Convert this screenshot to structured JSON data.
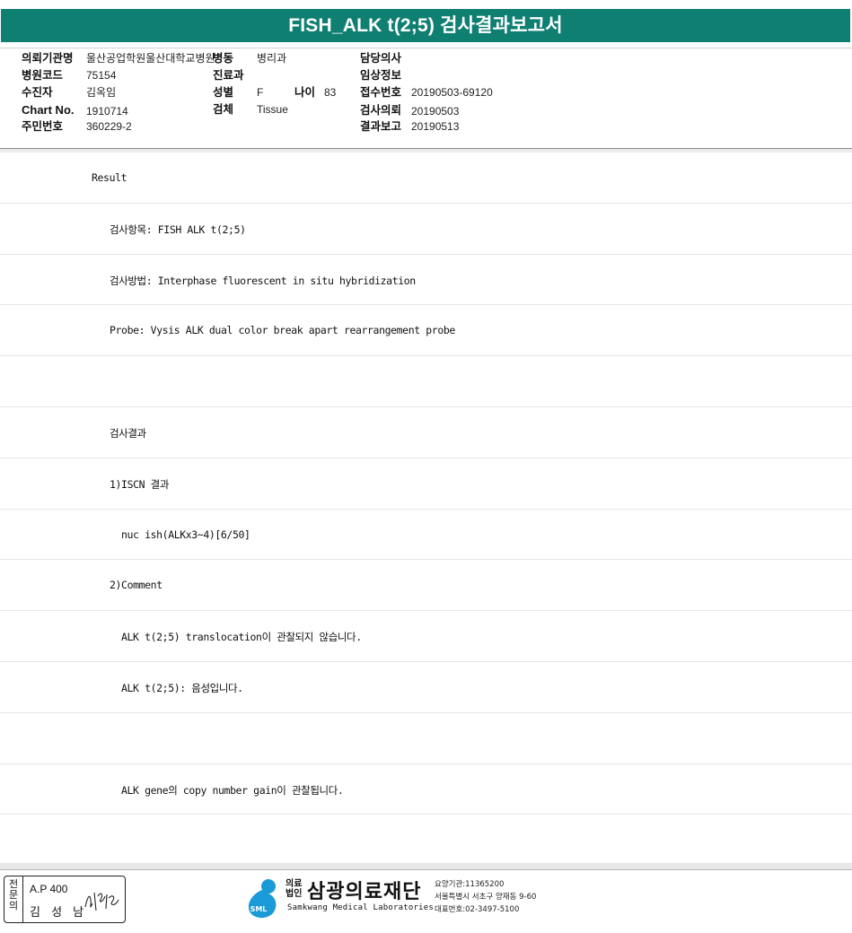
{
  "title": "FISH_ALK t(2;5) 검사결과보고서",
  "info": {
    "institution_label": "의뢰기관명",
    "institution_value": "울산공업학원울산대학교병원",
    "ward_label": "병동",
    "ward_value": "병리과",
    "doctor_label": "담당의사",
    "doctor_value": "",
    "hospital_code_label": "병원코드",
    "hospital_code_value": "75154",
    "dept_label": "진료과",
    "dept_value": "",
    "clinical_label": "임상정보",
    "clinical_value": "",
    "patient_label": "수진자",
    "patient_value": "김옥임",
    "sex_label": "성별",
    "sex_value": "F",
    "age_label": "나이",
    "age_value": "83",
    "receipt_label": "접수번호",
    "receipt_value": "20190503-69120",
    "chart_label": "Chart No.",
    "chart_value": "1910714",
    "specimen_label": "검체",
    "specimen_value": "Tissue",
    "request_label": "검사의뢰",
    "request_value": "20190503",
    "rrn_label": "주민번호",
    "rrn_value": "360229-2",
    "report_label": "결과보고",
    "report_value": "20190513"
  },
  "report_lines": [
    {
      "text": "Result",
      "indent": 0
    },
    {
      "text": "검사항목: FISH ALK t(2;5)",
      "indent": 1
    },
    {
      "text": "검사방법: Interphase fluorescent in situ hybridization",
      "indent": 1
    },
    {
      "text": "Probe: Vysis ALK dual color break apart rearrangement probe",
      "indent": 1
    },
    {
      "text": "",
      "indent": 1
    },
    {
      "text": "검사결과",
      "indent": 1
    },
    {
      "text": "1)ISCN 결과",
      "indent": 1
    },
    {
      "text": "nuc ish(ALKx3~4)[6/50]",
      "indent": 2
    },
    {
      "text": "2)Comment",
      "indent": 1
    },
    {
      "text": "ALK t(2;5) translocation이 관찰되지 않습니다.",
      "indent": 2
    },
    {
      "text": "ALK t(2;5): 음성입니다.",
      "indent": 2
    },
    {
      "text": "",
      "indent": 2
    },
    {
      "text": "ALK gene의 copy number gain이 관찰됩니다.",
      "indent": 2
    }
  ],
  "footer": {
    "specialist_chars": [
      "전",
      "문",
      "의"
    ],
    "ap_number": "A.P 400",
    "pathologist": "김 성 남",
    "org_prefix": "의료\n법인",
    "org_name": "삼광의료재단",
    "org_english": "Samkwang Medical Laboratories",
    "logo_text": "SML",
    "care_code": "요양기관:11365200",
    "address": "서울특별시 서초구 양재동 9-60",
    "phone": "대표번호:02-3497-5100",
    "brand_color": "#0f7f72",
    "logo_color": "#1a9ad6"
  }
}
